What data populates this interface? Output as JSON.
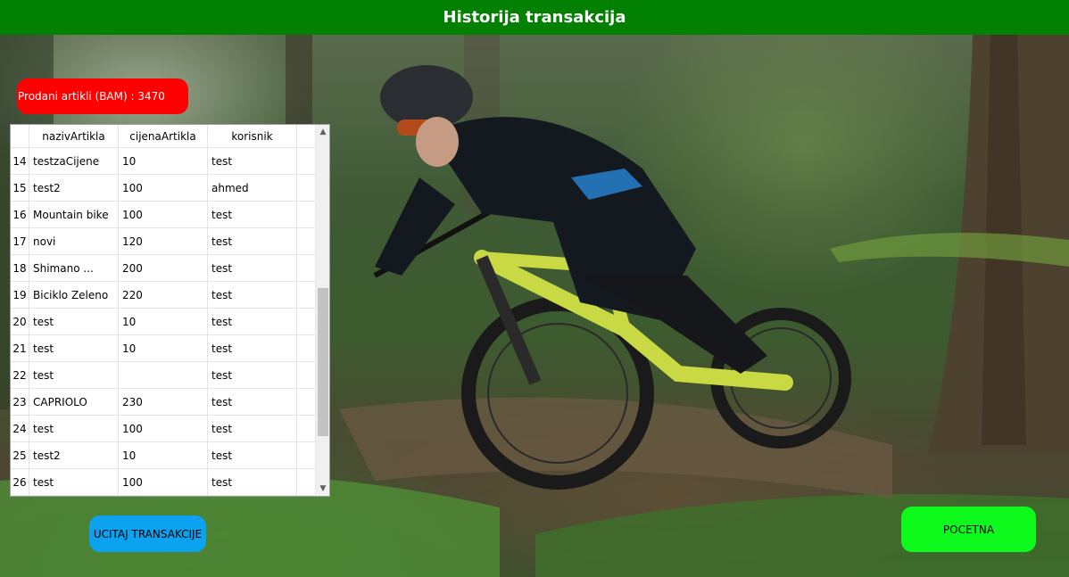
{
  "window": {
    "title": "Historija transakcija"
  },
  "summary": {
    "sold_label": "Prodani artikli (BAM) : 3470"
  },
  "grid": {
    "columns": [
      "nazivArtikla",
      "cijenaArtikla",
      "korisnik"
    ],
    "rows": [
      {
        "num": "14",
        "naziv": "testzaCijene",
        "cijena": "10",
        "korisnik": "test"
      },
      {
        "num": "15",
        "naziv": "test2",
        "cijena": "100",
        "korisnik": "ahmed"
      },
      {
        "num": "16",
        "naziv": "Mountain bike",
        "cijena": "100",
        "korisnik": "test"
      },
      {
        "num": "17",
        "naziv": "novi",
        "cijena": "120",
        "korisnik": "test"
      },
      {
        "num": "18",
        "naziv": "Shimano ...",
        "cijena": "200",
        "korisnik": "test"
      },
      {
        "num": "19",
        "naziv": "Biciklo Zeleno",
        "cijena": "220",
        "korisnik": "test"
      },
      {
        "num": "20",
        "naziv": "test",
        "cijena": "10",
        "korisnik": "test"
      },
      {
        "num": "21",
        "naziv": "test",
        "cijena": "10",
        "korisnik": "test"
      },
      {
        "num": "22",
        "naziv": "test",
        "cijena": "",
        "korisnik": "test"
      },
      {
        "num": "23",
        "naziv": "CAPRIOLO",
        "cijena": "230",
        "korisnik": "test"
      },
      {
        "num": "24",
        "naziv": "test",
        "cijena": "100",
        "korisnik": "test"
      },
      {
        "num": "25",
        "naziv": "test2",
        "cijena": "10",
        "korisnik": "test"
      },
      {
        "num": "26",
        "naziv": "test",
        "cijena": "100",
        "korisnik": "test"
      },
      {
        "num": "",
        "naziv": "",
        "cijena": "",
        "korisnik": ""
      }
    ]
  },
  "buttons": {
    "load_label": "UCITAJ TRANSAKCIJE",
    "home_label": "POCETNA"
  },
  "icons": {
    "scroll_up": "chevron-up-icon",
    "scroll_down": "chevron-down-icon"
  },
  "colors": {
    "title_bar": "#018001",
    "sold_badge": "#ff0000",
    "load_button": "#0ba2f0",
    "home_button": "#0ef91c"
  }
}
